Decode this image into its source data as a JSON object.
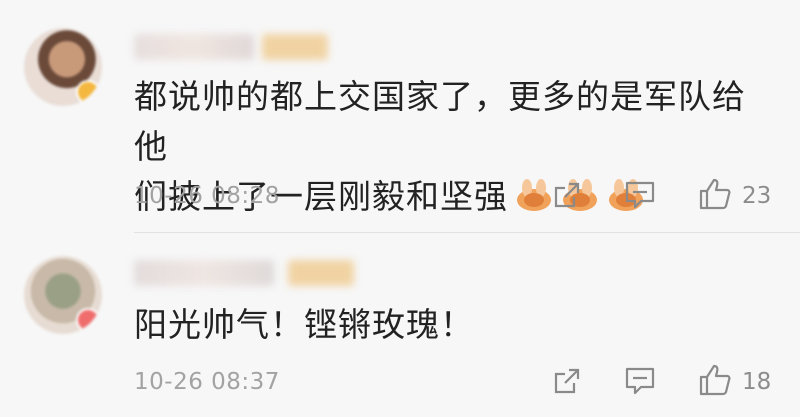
{
  "comments": [
    {
      "line1": "都说帅的都上交国家了，更多的是军队给他",
      "line2": "们披上了一层刚毅和坚强",
      "emoji_icons": [
        "clap-hands-emoji",
        "clap-hands-emoji",
        "clap-hands-emoji"
      ],
      "timestamp": "10-26 08:28",
      "likes": "23"
    },
    {
      "line1": "阳光帅气！铿锵玫瑰！",
      "timestamp": "10-26 08:37",
      "likes": "18"
    }
  ],
  "icons": {
    "share": "share-icon",
    "reply": "comment-icon",
    "like": "thumbs-up-icon"
  },
  "colors": {
    "background": "#f7f7f7",
    "text": "#222222",
    "meta": "#a2a2a2",
    "badge": "#f4b73f"
  }
}
